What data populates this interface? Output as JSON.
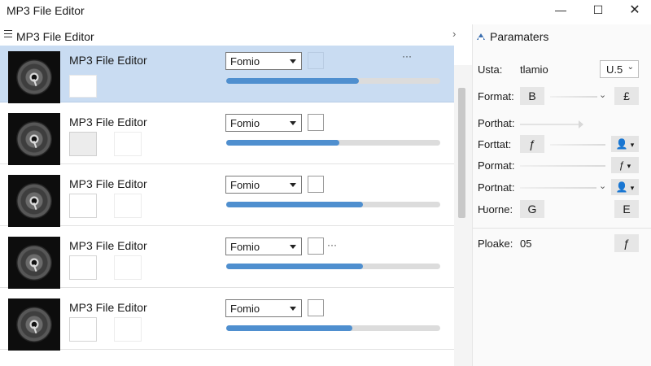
{
  "window": {
    "title": "MP3 File Editor",
    "minimize_glyph": "—",
    "maximize_glyph": "☐",
    "close_glyph": "✕"
  },
  "list": {
    "header_title": "MP3 File Editor",
    "collapse_glyph": "›",
    "rows": [
      {
        "title": "MP3 File Editor",
        "format": "Fomio",
        "progress": 0.62,
        "selected": true,
        "more": "···"
      },
      {
        "title": "MP3 File Editor",
        "format": "Fomio",
        "progress": 0.53,
        "selected": false,
        "more": ""
      },
      {
        "title": "MP3 File Editor",
        "format": "Fomio",
        "progress": 0.64,
        "selected": false,
        "more": ""
      },
      {
        "title": "MP3 File Editor",
        "format": "Fomio",
        "progress": 0.64,
        "selected": false,
        "more": "···"
      },
      {
        "title": "MP3 File Editor",
        "format": "Fomio",
        "progress": 0.59,
        "selected": false,
        "more": ""
      }
    ],
    "scroll_down_glyph": "⌄"
  },
  "params": {
    "title": "Paramaters",
    "rows": [
      {
        "label": "Usta:",
        "value": "tlamio",
        "select": "U.5"
      },
      {
        "label": "Format:",
        "button_left": "B",
        "button_right": "£"
      },
      {
        "label": "Porthat:"
      },
      {
        "label": "Forttat:",
        "button_left": "ƒ",
        "person": "👤"
      },
      {
        "label": "Pormat:",
        "right_glyph": "ƒ"
      },
      {
        "label": "Portnat:",
        "person": "👤"
      },
      {
        "label": "Ƕorne:",
        "button_left": "G",
        "button_right": "E"
      },
      {
        "label": "Ploake:",
        "value": "05",
        "button_right": "ƒ"
      }
    ]
  },
  "colors": {
    "selected_row": "#c9dcf2",
    "progress_fill": "#4f8fcf",
    "progress_track": "#dcdcdc"
  }
}
